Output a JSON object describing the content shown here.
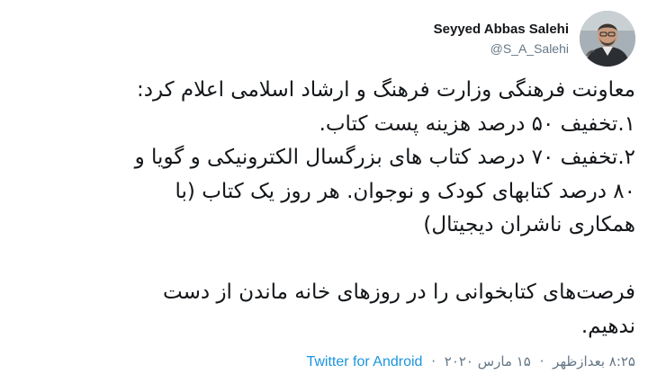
{
  "user": {
    "display_name": "Seyyed Abbas Salehi",
    "handle": "@S_A_Salehi"
  },
  "tweet": {
    "lines": [
      "معاونت فرهنگی وزارت فرهنگ و ارشاد اسلامی اعلام کرد:",
      "۱.تخفیف ۵۰ درصد هزینه پست کتاب.",
      "۲.تخفیف ۷۰ درصد کتاب های بزرگسال الکترونیکی و گویا و",
      "۸۰ درصد کتابهای کودک و نوجوان. هر روز یک کتاب (با",
      "همکاری ناشران دیجیتال)",
      "",
      "فرصت‌های کتابخوانی را در روزهای خانه ماندن از دست",
      "ندهیم."
    ]
  },
  "meta": {
    "time": "۸:۲۵ بعدازظهر",
    "separator": "·",
    "date": "۱۵ مارس ۲۰۲۰",
    "source": "Twitter for Android"
  }
}
